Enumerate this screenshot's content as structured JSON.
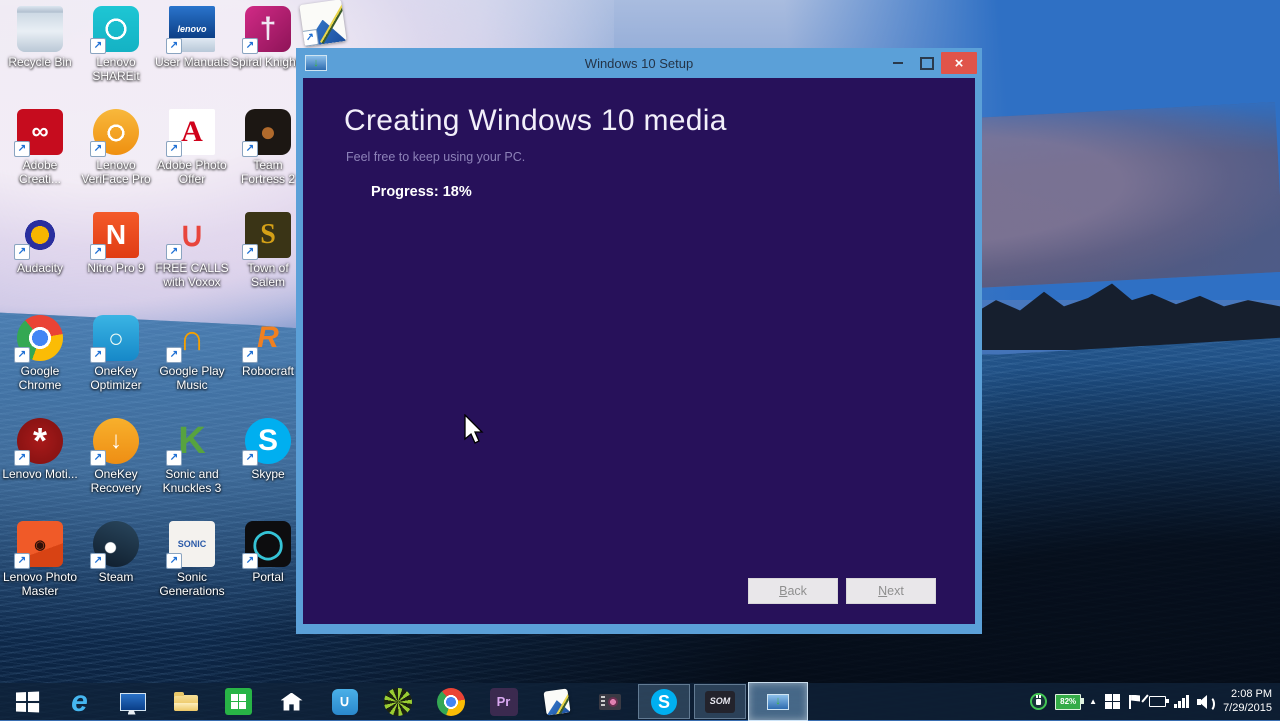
{
  "window": {
    "title": "Windows 10 Setup",
    "icon_glyph": "↓",
    "heading": "Creating Windows 10 media",
    "subtitle": "Feel free to keep using your PC.",
    "progress_label": "Progress: 18%",
    "controls": {
      "close_glyph": "×"
    },
    "buttons": {
      "back": {
        "key": "B",
        "rest": "ack"
      },
      "next": {
        "key": "N",
        "rest": "ext"
      }
    }
  },
  "colors": {
    "titlebar": "#5ba0d8",
    "window_background": "#27115a",
    "close_button": "#e0544a",
    "taskbar": "rgba(16,34,58,0.78)"
  },
  "desktop": {
    "badge_glyph": "↗",
    "icons": [
      {
        "id": "recycle-bin",
        "label": "Recycle Bin",
        "noBadge": true,
        "radius": "4px 4px 8px 8px",
        "bg": "linear-gradient(180deg,#dce6f0 0%,#b0bece 14%,#cdd9e4 15%,#e9eff5 55%,#bac8d6 100%)"
      },
      {
        "id": "lenovo-shareit",
        "label": "Lenovo SHAREit",
        "radius": "9px",
        "bg": "radial-gradient(circle at 50% 50%, rgba(0,0,0,0) 0 8px, #fff 8px 10.5px, rgba(0,0,0,0) 10.5px), linear-gradient(180deg,#1ec6d4,#14b2c4)"
      },
      {
        "id": "user-manuals",
        "label": "User Manuals",
        "radius": "2px",
        "glyph": "lenovo",
        "fg": "#fff",
        "fs": 9,
        "italic": true,
        "bg": "linear-gradient(180deg,#2a74cc 0%,#0c3f86 70%,#dfe8f2 70%,#b8c8d8 100%)"
      },
      {
        "id": "spiral-knights",
        "label": "Spiral Knights",
        "radius": "9px",
        "glyph": "†",
        "fg": "#f0e8f4",
        "fs": 30,
        "bg": "linear-gradient(135deg,#d12a86,#8e1458)"
      },
      {
        "id": "adobe-creative-cloud",
        "label": "Adobe Creati...",
        "radius": "6px",
        "glyph": "∞",
        "fg": "#fff",
        "fs": 24,
        "bold": true,
        "bg": "#c60c1e"
      },
      {
        "id": "lenovo-veriface-pro",
        "label": "Lenovo VeriFace Pro",
        "circle": true,
        "bg": "radial-gradient(circle at 50% 52%, rgba(0,0,0,0) 0 6px, #fff 6px 8.5px, rgba(0,0,0,0) 8.5px), linear-gradient(180deg,#f8b83c,#ef9010)"
      },
      {
        "id": "adobe-photo-offer",
        "label": "Adobe Photo Offer",
        "radius": "2px",
        "glyph": "A",
        "fg": "#d0021b",
        "fs": 30,
        "serif": true,
        "bold": true,
        "bg": "#fff"
      },
      {
        "id": "team-fortress-2",
        "label": "Team Fortress 2",
        "radius": "10px",
        "glyph": "●",
        "fg": "#b06a2c",
        "fs": 28,
        "bg": "#1c1713"
      },
      {
        "id": "audacity",
        "label": "Audacity",
        "bg": "radial-gradient(circle at 50% 50%, #f7b500 0 9px, #2a2f9e 9px 15px, rgba(0,0,0,0) 15px)"
      },
      {
        "id": "nitro-pro-9",
        "label": "Nitro Pro 9",
        "radius": "4px",
        "glyph": "N",
        "fg": "#fff",
        "fs": 28,
        "bold": true,
        "bg": "linear-gradient(180deg,#f45a2a,#e03c14)"
      },
      {
        "id": "voxox",
        "label": "FREE CALLS with Voxox",
        "glyph": "∪",
        "fg": "#e8453c",
        "fs": 34,
        "bold": true
      },
      {
        "id": "town-of-salem",
        "label": "Town of Salem",
        "radius": "4px",
        "glyph": "S",
        "fg": "#d4a017",
        "fs": 28,
        "serif": true,
        "bold": true,
        "bg": "#3a3416"
      },
      {
        "id": "google-chrome",
        "label": "Google Chrome",
        "circle": true,
        "bg": "radial-gradient(circle at 50% 50%, #4285f4 0 8px, #fff 8px 11px, rgba(0,0,0,0) 11px), conic-gradient(from -40deg, #ea4335 0deg 120deg, #fbbc05 120deg 240deg, #34a853 240deg 360deg)"
      },
      {
        "id": "onekey-optimizer",
        "label": "OneKey Optimizer",
        "radius": "10px",
        "glyph": "○",
        "fg": "#eafaf4",
        "fs": 26,
        "bold": true,
        "bg": "linear-gradient(180deg,#3ab4e4,#1688c8)"
      },
      {
        "id": "google-play-music",
        "label": "Google Play Music",
        "glyph": "∩",
        "fg": "#f5a000",
        "fs": 36,
        "bold": true
      },
      {
        "id": "robocraft",
        "label": "Robocraft",
        "glyph": "R",
        "fg": "#f08020",
        "fs": 30,
        "bold": true,
        "italic": true
      },
      {
        "id": "lenovo-motion",
        "label": "Lenovo Moti...",
        "circle": true,
        "glyph": "*",
        "fg": "#fff",
        "fs": 36,
        "bg": "radial-gradient(circle,#a81a1a,#7e1010)"
      },
      {
        "id": "onekey-recovery",
        "label": "OneKey Recovery",
        "circle": true,
        "glyph": "↓",
        "fg": "#fff",
        "fs": 24,
        "bold": true,
        "bg": "linear-gradient(180deg,#f8b02c,#ee8e14)"
      },
      {
        "id": "sonic-and-knuckles-3",
        "label": "Sonic and Knuckles 3",
        "glyph": "K",
        "fg": "#57a33f",
        "fs": 38,
        "bold": true
      },
      {
        "id": "skype-desktop",
        "label": "Skype",
        "circle": true,
        "glyph": "S",
        "fg": "#fff",
        "fs": 30,
        "bold": true,
        "bg": "#00aff0"
      },
      {
        "id": "lenovo-photo-master",
        "label": "Lenovo Photo Master",
        "radius": "6px",
        "glyph": "◉",
        "fg": "#301008",
        "fs": 13,
        "bg": "linear-gradient(160deg,#f05a28 62%,#d84314 62%)"
      },
      {
        "id": "steam",
        "label": "Steam",
        "circle": true,
        "bg": "radial-gradient(circle at 38% 58%, #ffffff 0 5px, rgba(0,0,0,0) 6px), linear-gradient(200deg,#2a475e,#0e1c2b)"
      },
      {
        "id": "sonic-generations",
        "label": "Sonic Generations",
        "radius": "4px",
        "glyph": "SONIC",
        "fg": "#2a5aa8",
        "fs": 9,
        "bold": true,
        "bg": "#f4f2ee"
      },
      {
        "id": "portal",
        "label": "Portal",
        "radius": "8px",
        "glyph": "◯",
        "fg": "#35c4d7",
        "fs": 28,
        "bold": true,
        "bg": "#0d0d0f"
      }
    ]
  },
  "taskbar": {
    "apps": [
      {
        "id": "start",
        "panes": true
      },
      {
        "id": "internet-explorer",
        "glyph": "e",
        "fg": "#45b6f0",
        "fs": 30,
        "italic": true,
        "bold": true
      },
      {
        "id": "lenovo-user-manuals",
        "shape": "monitor"
      },
      {
        "id": "file-explorer",
        "shape": "folder"
      },
      {
        "id": "windows-store",
        "shape": "store",
        "panes": true
      },
      {
        "id": "home",
        "shape": "house"
      },
      {
        "id": "lenovo-app-store",
        "bg": "linear-gradient(180deg,#4ab0e8,#2a88cc)",
        "radius": "6px",
        "glyph": "∪",
        "fg": "#fff",
        "fs": 15,
        "bold": true,
        "w": 26,
        "h": 26
      },
      {
        "id": "media-app",
        "circle": true,
        "bg": "repeating-conic-gradient(#9acd32 0deg 18deg, #1c2410 18deg 40deg)",
        "w": 28,
        "h": 28
      },
      {
        "id": "google-chrome-taskbar",
        "circle": true,
        "w": 28,
        "h": 28,
        "bg": "radial-gradient(circle at 50% 50%, #4285f4 0 5px, #fff 5px 7px, rgba(0,0,0,0) 7px), conic-gradient(from -40deg, #ea4335 0deg 120deg, #fbbc05 120deg 240deg, #34a853 240deg 360deg)"
      },
      {
        "id": "premiere-pro",
        "bg": "#3b2a4f",
        "radius": "4px",
        "glyph": "Pr",
        "fg": "#d9a8f0",
        "fs": 13,
        "bold": true,
        "w": 28,
        "h": 28
      },
      {
        "id": "photo-editor",
        "shape": "photoedit-small"
      },
      {
        "id": "movie-app",
        "shape": "movie"
      },
      {
        "id": "skype",
        "open": true,
        "circle": true,
        "glyph": "S",
        "fg": "#fff",
        "fs": 18,
        "bold": true,
        "w": 26,
        "h": 26,
        "bg": "#00aff0"
      },
      {
        "id": "som",
        "open": true,
        "glyph": "SOM",
        "fg": "#e8e8f0",
        "fs": 9,
        "bold": true,
        "italic": true,
        "w": 30,
        "h": 22,
        "radius": "3px",
        "bg": "#23232c"
      },
      {
        "id": "media-creation-tool",
        "active": true,
        "shape": "mct",
        "glyph": "↓",
        "fg": "#3dbb3d"
      }
    ],
    "tray": {
      "battery_percent": "82%",
      "hidden_icons_glyph": "▲",
      "time": "2:08 PM",
      "date": "7/29/2015"
    }
  }
}
